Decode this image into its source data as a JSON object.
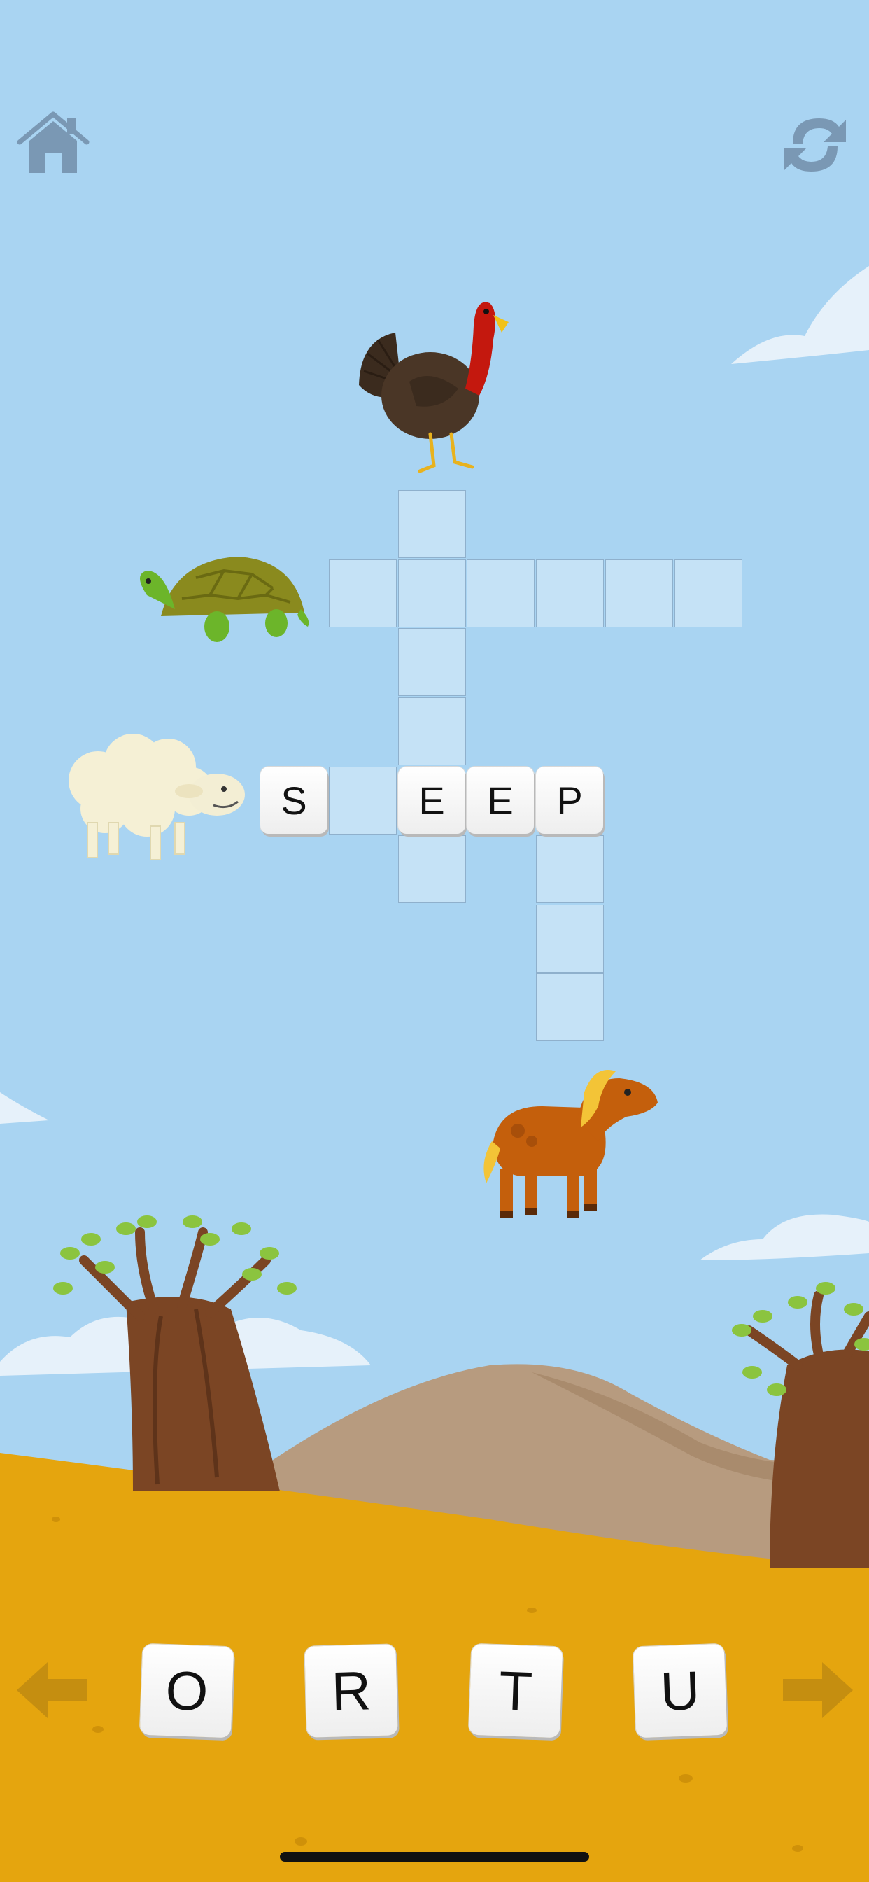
{
  "hud": {
    "home_icon": "home-icon",
    "restart_icon": "refresh-icon"
  },
  "crossword": {
    "animals": [
      "turkey",
      "turtle",
      "sheep",
      "horse"
    ],
    "row_sheep": [
      "S",
      "",
      "E",
      "E",
      "P"
    ]
  },
  "letter_bank": {
    "letters": [
      "O",
      "R",
      "T",
      "U"
    ],
    "prev_icon": "arrow-left-icon",
    "next_icon": "arrow-right-icon"
  },
  "colors": {
    "sky": "#a9d4f2",
    "sand": "#e5a50e",
    "cell": "#c5e2f6",
    "cell_border": "#8fb0cc"
  }
}
